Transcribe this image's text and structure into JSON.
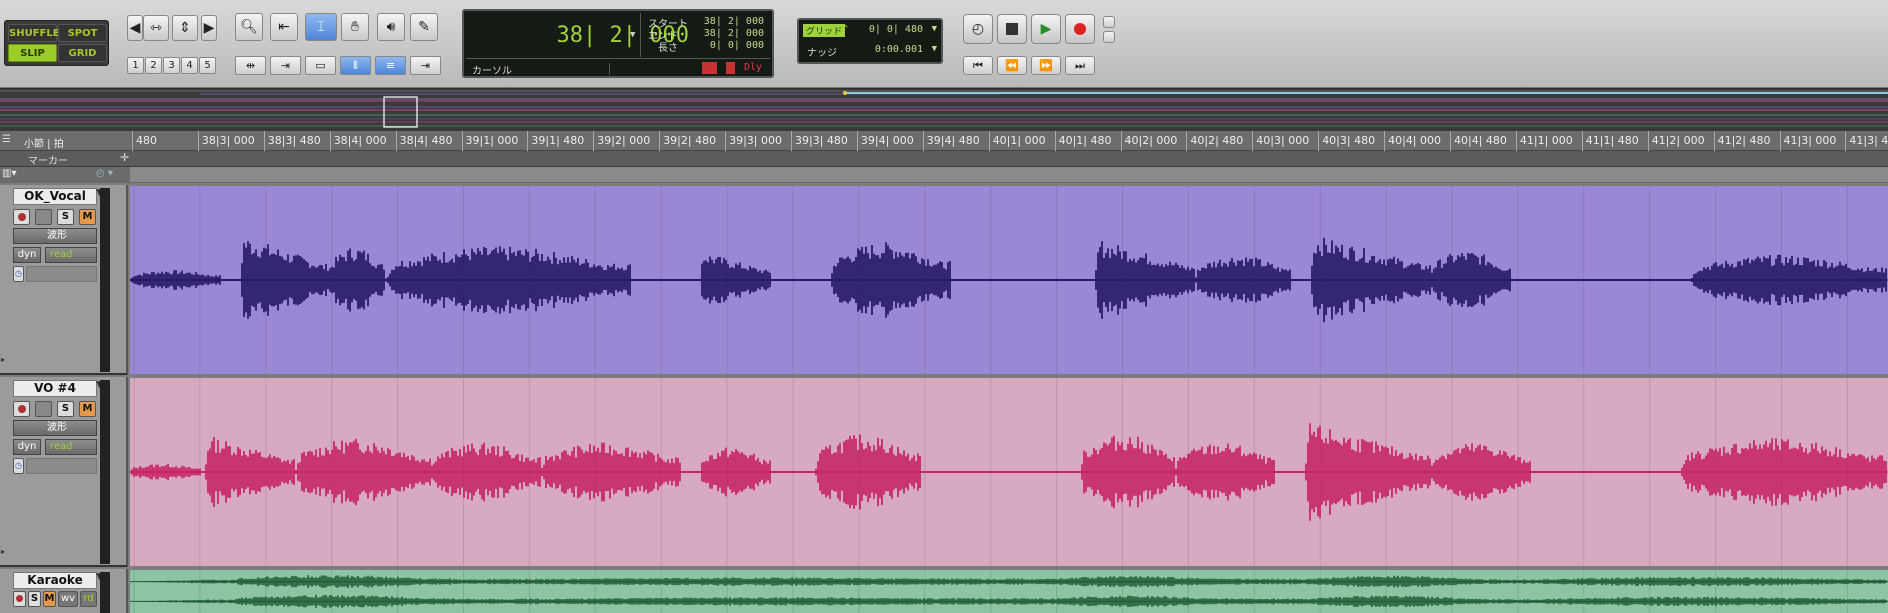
{
  "edit_modes": {
    "shuffle": "SHUFFLE",
    "spot": "SPOT",
    "slip": "SLIP",
    "grid": "GRID",
    "active": "SLIP"
  },
  "zoom_presets": [
    "1",
    "2",
    "3",
    "4",
    "5"
  ],
  "counter": {
    "main": "38| 2| 000",
    "start_label": "スタート",
    "end_label": "エンド",
    "length_label": "長さ",
    "start": "38| 2| 000",
    "end": "38| 2| 000",
    "length": "0| 0| 000",
    "cursor_label": "カーソル",
    "dly": "Dly"
  },
  "grid_nudge": {
    "grid_label": "グリッド",
    "grid_value": "0| 0| 480",
    "nudge_label": "ナッジ",
    "nudge_value": "0:00.001"
  },
  "ruler": {
    "label": "小節 | 拍",
    "marker_label": "マーカー",
    "ticks": [
      "480",
      "38|3| 000",
      "38|3| 480",
      "38|4| 000",
      "38|4| 480",
      "39|1| 000",
      "39|1| 480",
      "39|2| 000",
      "39|2| 480",
      "39|3| 000",
      "39|3| 480",
      "39|4| 000",
      "39|4| 480",
      "40|1| 000",
      "40|1| 480",
      "40|2| 000",
      "40|2| 480",
      "40|3| 000",
      "40|3| 480",
      "40|4| 000",
      "40|4| 480",
      "41|1| 000",
      "41|1| 480",
      "41|2| 000",
      "41|2| 480",
      "41|3| 000",
      "41|3| 480"
    ]
  },
  "tracks": [
    {
      "name": "OK_Vocal",
      "view": "波形",
      "automation_mode": "read",
      "dyn": "dyn",
      "solo": "S",
      "mute": "M",
      "lane_color": "#9b88d4",
      "wave_color": "#1c0e5c"
    },
    {
      "name": "VO #4",
      "view": "波形",
      "automation_mode": "read",
      "dyn": "dyn",
      "solo": "S",
      "mute": "M",
      "lane_color": "#d8aac2",
      "wave_color": "#c4185a"
    },
    {
      "name": "Karaoke",
      "solo": "S",
      "mute": "M",
      "wv": "wv",
      "rd": "rd",
      "lane_color": "#8ec4a4",
      "wave_color": "#1b5a34"
    }
  ]
}
